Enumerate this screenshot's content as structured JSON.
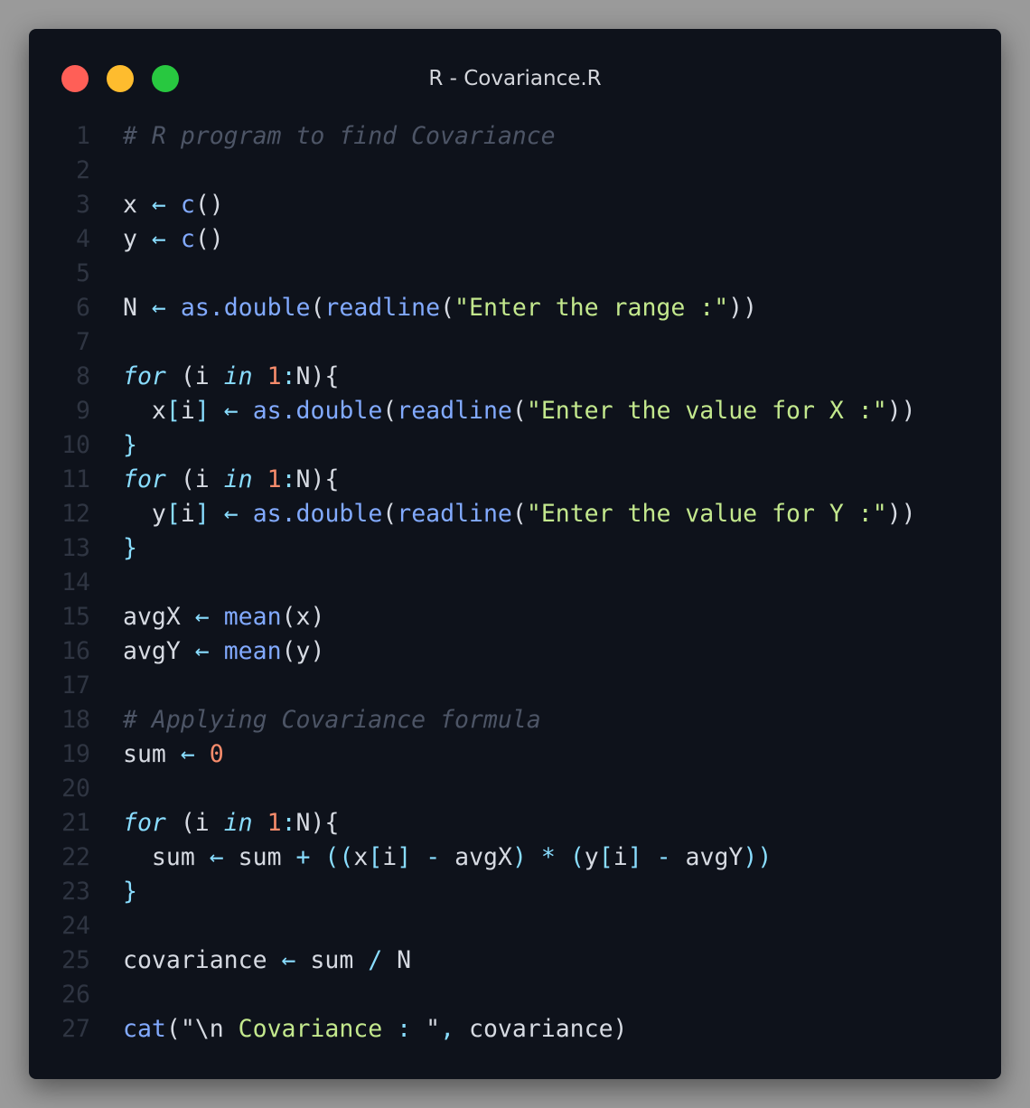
{
  "window": {
    "title": "R - Covariance.R",
    "controls": [
      {
        "name": "close",
        "color": "#ff5f57"
      },
      {
        "name": "minimize",
        "color": "#febc2e"
      },
      {
        "name": "maximize",
        "color": "#28c840"
      }
    ]
  },
  "colors": {
    "background": "#0e121b",
    "comment": "#4d5566",
    "identifier": "#d6dae2",
    "operator": "#89ddff",
    "function": "#82aaff",
    "string": "#c3e88d",
    "number": "#f78c6c",
    "keyword": "#89ddff",
    "line_number": "#2f3542"
  },
  "code": {
    "lines": [
      {
        "n": "1",
        "tokens": [
          [
            "comment",
            "# R program to find Covariance"
          ]
        ]
      },
      {
        "n": "2",
        "tokens": []
      },
      {
        "n": "3",
        "tokens": [
          [
            "ident",
            "x "
          ],
          [
            "op",
            "←"
          ],
          [
            "ident",
            " "
          ],
          [
            "func",
            "c"
          ],
          [
            "punc",
            "()"
          ]
        ]
      },
      {
        "n": "4",
        "tokens": [
          [
            "ident",
            "y "
          ],
          [
            "op",
            "←"
          ],
          [
            "ident",
            " "
          ],
          [
            "func",
            "c"
          ],
          [
            "punc",
            "()"
          ]
        ]
      },
      {
        "n": "5",
        "tokens": []
      },
      {
        "n": "6",
        "tokens": [
          [
            "ident",
            "N "
          ],
          [
            "op",
            "←"
          ],
          [
            "ident",
            " "
          ],
          [
            "func",
            "as.double"
          ],
          [
            "punc",
            "("
          ],
          [
            "func",
            "readline"
          ],
          [
            "punc",
            "("
          ],
          [
            "str",
            "\"Enter the range :\""
          ],
          [
            "punc",
            "))"
          ]
        ]
      },
      {
        "n": "7",
        "tokens": []
      },
      {
        "n": "8",
        "tokens": [
          [
            "kw",
            "for"
          ],
          [
            "punc",
            " (i "
          ],
          [
            "kw",
            "in"
          ],
          [
            "punc",
            " "
          ],
          [
            "num",
            "1"
          ],
          [
            "op",
            ":"
          ],
          [
            "punc",
            "N){"
          ]
        ]
      },
      {
        "n": "9",
        "tokens": [
          [
            "ident",
            "  x"
          ],
          [
            "op",
            "["
          ],
          [
            "ident",
            "i"
          ],
          [
            "op",
            "]"
          ],
          [
            "ident",
            " "
          ],
          [
            "op",
            "←"
          ],
          [
            "ident",
            " "
          ],
          [
            "func",
            "as.double"
          ],
          [
            "punc",
            "("
          ],
          [
            "func",
            "readline"
          ],
          [
            "punc",
            "("
          ],
          [
            "str",
            "\"Enter the value for X :\""
          ],
          [
            "punc",
            "))"
          ]
        ]
      },
      {
        "n": "10",
        "tokens": [
          [
            "op",
            "}"
          ]
        ]
      },
      {
        "n": "11",
        "tokens": [
          [
            "kw",
            "for"
          ],
          [
            "punc",
            " (i "
          ],
          [
            "kw",
            "in"
          ],
          [
            "punc",
            " "
          ],
          [
            "num",
            "1"
          ],
          [
            "op",
            ":"
          ],
          [
            "punc",
            "N){"
          ]
        ]
      },
      {
        "n": "12",
        "tokens": [
          [
            "ident",
            "  y"
          ],
          [
            "op",
            "["
          ],
          [
            "ident",
            "i"
          ],
          [
            "op",
            "]"
          ],
          [
            "ident",
            " "
          ],
          [
            "op",
            "←"
          ],
          [
            "ident",
            " "
          ],
          [
            "func",
            "as.double"
          ],
          [
            "punc",
            "("
          ],
          [
            "func",
            "readline"
          ],
          [
            "punc",
            "("
          ],
          [
            "str",
            "\"Enter the value for Y :\""
          ],
          [
            "punc",
            "))"
          ]
        ]
      },
      {
        "n": "13",
        "tokens": [
          [
            "op",
            "}"
          ]
        ]
      },
      {
        "n": "14",
        "tokens": []
      },
      {
        "n": "15",
        "tokens": [
          [
            "ident",
            "avgX "
          ],
          [
            "op",
            "←"
          ],
          [
            "ident",
            " "
          ],
          [
            "func",
            "mean"
          ],
          [
            "punc",
            "(x)"
          ]
        ]
      },
      {
        "n": "16",
        "tokens": [
          [
            "ident",
            "avgY "
          ],
          [
            "op",
            "←"
          ],
          [
            "ident",
            " "
          ],
          [
            "func",
            "mean"
          ],
          [
            "punc",
            "(y)"
          ]
        ]
      },
      {
        "n": "17",
        "tokens": []
      },
      {
        "n": "18",
        "tokens": [
          [
            "comment",
            "# Applying Covariance formula"
          ]
        ]
      },
      {
        "n": "19",
        "tokens": [
          [
            "ident",
            "sum "
          ],
          [
            "op",
            "←"
          ],
          [
            "ident",
            " "
          ],
          [
            "num",
            "0"
          ]
        ]
      },
      {
        "n": "20",
        "tokens": []
      },
      {
        "n": "21",
        "tokens": [
          [
            "kw",
            "for"
          ],
          [
            "punc",
            " (i "
          ],
          [
            "kw",
            "in"
          ],
          [
            "punc",
            " "
          ],
          [
            "num",
            "1"
          ],
          [
            "op",
            ":"
          ],
          [
            "punc",
            "N){"
          ]
        ]
      },
      {
        "n": "22",
        "tokens": [
          [
            "ident",
            "  sum "
          ],
          [
            "op",
            "←"
          ],
          [
            "ident",
            " sum "
          ],
          [
            "op",
            "+"
          ],
          [
            "ident",
            " "
          ],
          [
            "op",
            "(("
          ],
          [
            "ident",
            "x"
          ],
          [
            "op",
            "["
          ],
          [
            "ident",
            "i"
          ],
          [
            "op",
            "]"
          ],
          [
            "ident",
            " "
          ],
          [
            "op",
            "-"
          ],
          [
            "ident",
            " avgX"
          ],
          [
            "op",
            ")"
          ],
          [
            "ident",
            " "
          ],
          [
            "op",
            "*"
          ],
          [
            "ident",
            " "
          ],
          [
            "op",
            "("
          ],
          [
            "ident",
            "y"
          ],
          [
            "op",
            "["
          ],
          [
            "ident",
            "i"
          ],
          [
            "op",
            "]"
          ],
          [
            "ident",
            " "
          ],
          [
            "op",
            "-"
          ],
          [
            "ident",
            " avgY"
          ],
          [
            "op",
            "))"
          ]
        ]
      },
      {
        "n": "23",
        "tokens": [
          [
            "op",
            "}"
          ]
        ]
      },
      {
        "n": "24",
        "tokens": []
      },
      {
        "n": "25",
        "tokens": [
          [
            "ident",
            "covariance "
          ],
          [
            "op",
            "←"
          ],
          [
            "ident",
            " sum "
          ],
          [
            "op",
            "/"
          ],
          [
            "ident",
            " N"
          ]
        ]
      },
      {
        "n": "26",
        "tokens": []
      },
      {
        "n": "27",
        "tokens": [
          [
            "func",
            "cat"
          ],
          [
            "punc",
            "(\"\\n "
          ],
          [
            "str",
            "Covariance"
          ],
          [
            "punc",
            " "
          ],
          [
            "op",
            ":"
          ],
          [
            "punc",
            " \""
          ],
          [
            "op",
            ","
          ],
          [
            "ident",
            " covariance"
          ],
          [
            "punc",
            ")"
          ]
        ]
      }
    ]
  }
}
